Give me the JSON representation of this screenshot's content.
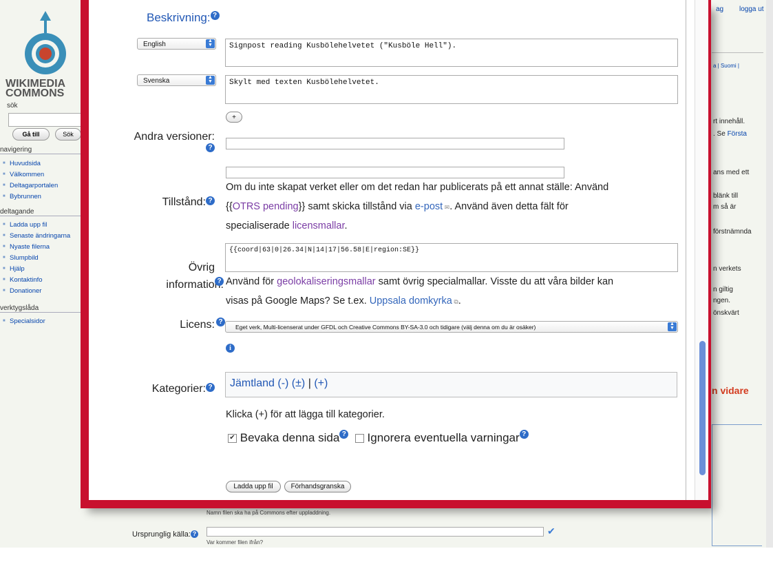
{
  "sidebar": {
    "logo_text_1": "WIKIMEDIA",
    "logo_text_2": "COMMONS",
    "search_label": "sök",
    "go_button": "Gå till",
    "search_button": "Sök",
    "nav_heading": "navigering",
    "nav_items": [
      "Huvudsida",
      "Välkommen",
      "Deltagarportalen",
      "Bybrunnen"
    ],
    "participate_heading": "deltagande",
    "participate_items": [
      "Ladda upp fil",
      "Senaste ändringarna",
      "Nyaste filerna",
      "Slumpbild",
      "Hjälp",
      "Kontaktinfo",
      "Donationer"
    ],
    "tools_heading": "verktygslåda",
    "tools_items": [
      "Specialsidor"
    ]
  },
  "right_panel": {
    "top_link_partial": "ag",
    "logout": "logga ut",
    "lang_partial": "a | Suomi |",
    "t1": "rt innehåll.",
    "t2": ". Se ",
    "t2_link": "Första",
    "t3": "ans med ett",
    "t4": "blänk till",
    "t5": "m så är",
    "t6": "förstnämnda",
    "t7": "n verkets",
    "t8": "n giltig",
    "t9": "ngen.",
    "t10": "önskvärt",
    "read_more": "n vidare"
  },
  "background_form": {
    "filename_hint": "Namn filen ska ha på Commons efter uppladdning.",
    "source_label": "Ursprunglig källa:",
    "source_hint": "Var kommer filen ifrån?"
  },
  "form": {
    "description_label": "Beskrivning:",
    "desc_rows": [
      {
        "language": "English",
        "text": "Signpost reading Kusbölehelvetet (\"Kusböle Hell\")."
      },
      {
        "language": "Svenska",
        "text": "Skylt med texten Kusbölehelvetet."
      }
    ],
    "add_button": "+",
    "other_versions_label": "Andra versioner:",
    "permission_label": "Tillstånd:",
    "permission_text_1": "Om du inte skapat verket eller om det redan har publicerats på ett annat ställe: Använd",
    "permission_text_2a": "{{",
    "permission_link_otrs": "OTRS pending",
    "permission_text_2b": "}} samt skicka tillstånd via ",
    "permission_link_email": "e-post",
    "permission_text_2c": ". Använd även detta fält för",
    "permission_text_3a": "specialiserade ",
    "permission_link_licenses": "licensmallar",
    "permission_text_3b": ".",
    "other_info_label_1": "Övrig",
    "other_info_label_2": "information:",
    "other_info_value": "{{coord|63|0|26.34|N|14|17|56.58|E|region:SE}}",
    "other_info_text_1a": "Använd för ",
    "other_info_link_geo": "geolokaliseringsmallar",
    "other_info_text_1b": " samt övrig specialmallar. Visste du att våra bilder kan",
    "other_info_text_2a": "visas på Google Maps? Se t.ex. ",
    "other_info_link_uppsala": "Uppsala domkyrka",
    "other_info_text_2b": ".",
    "license_label": "Licens:",
    "license_value": "Eget verk, Multi-licenserat under GFDL och Creative Commons BY-SA-3.0 och tidigare (välj denna om du är osäker)",
    "categories_label": "Kategorier:",
    "category_name": "Jämtland",
    "category_ops": "(-) (±)",
    "category_sep": "|",
    "category_add": "(+)",
    "categories_hint": "Klicka (+) för att lägga till kategorier.",
    "watch_label": "Bevaka denna sida",
    "ignore_label": "Ignorera eventuella varningar",
    "upload_button": "Ladda upp fil",
    "preview_button": "Förhandsgranska"
  },
  "colors": {
    "modal_border": "#c8102e",
    "link": "#3366bb",
    "visited_link": "#7b3da5",
    "help_icon": "#2e6cc8"
  }
}
